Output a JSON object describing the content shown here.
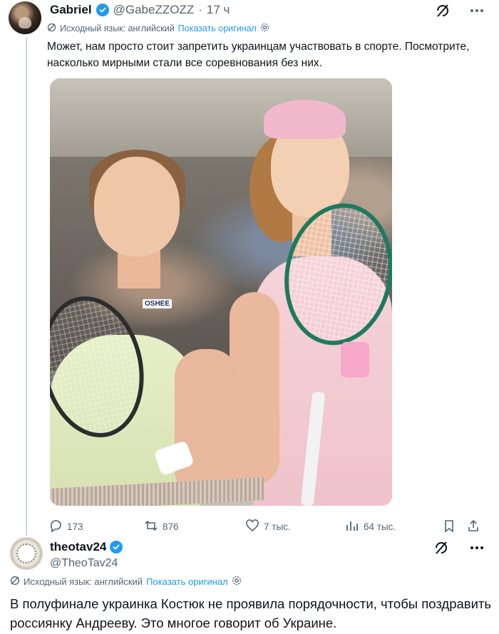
{
  "tweet1": {
    "name": "Gabriel",
    "handle": "@GabeZZOZZ",
    "separator": "·",
    "time": "17 ч",
    "translation": {
      "source_label": "Исходный язык: английский",
      "show_original": "Показать оригинал"
    },
    "text": "Может, нам просто стоит запретить украинцам участвовать в спорте. Посмотрите, насколько мирными стали все соревнования без них.",
    "photo": {
      "sponsor_badge": "OSHEE"
    },
    "actions": {
      "replies": "173",
      "reposts": "876",
      "likes": "7 тыс.",
      "views": "64 тыс."
    }
  },
  "tweet2": {
    "name": "theotav24",
    "handle": "@TheoTav24",
    "translation": {
      "source_label": "Исходный язык: английский",
      "show_original": "Показать оригинал"
    },
    "text": "В полуфинале украинка Костюк не проявила порядочности, чтобы поздравить россиянку Андрееву. Это многое говорит об Украине."
  },
  "icons": {
    "verified": "verified-badge-icon",
    "grok": "grok-icon",
    "more": "more-dots-icon",
    "translate": "translate-icon",
    "settings": "gear-icon",
    "reply": "reply-icon",
    "repost": "repost-icon",
    "like": "heart-icon",
    "views": "views-icon",
    "bookmark": "bookmark-icon",
    "share": "share-icon"
  },
  "colors": {
    "text": "#0f1419",
    "secondary": "#536471",
    "link": "#1d9bf0",
    "verified": "#1d9bf0"
  }
}
